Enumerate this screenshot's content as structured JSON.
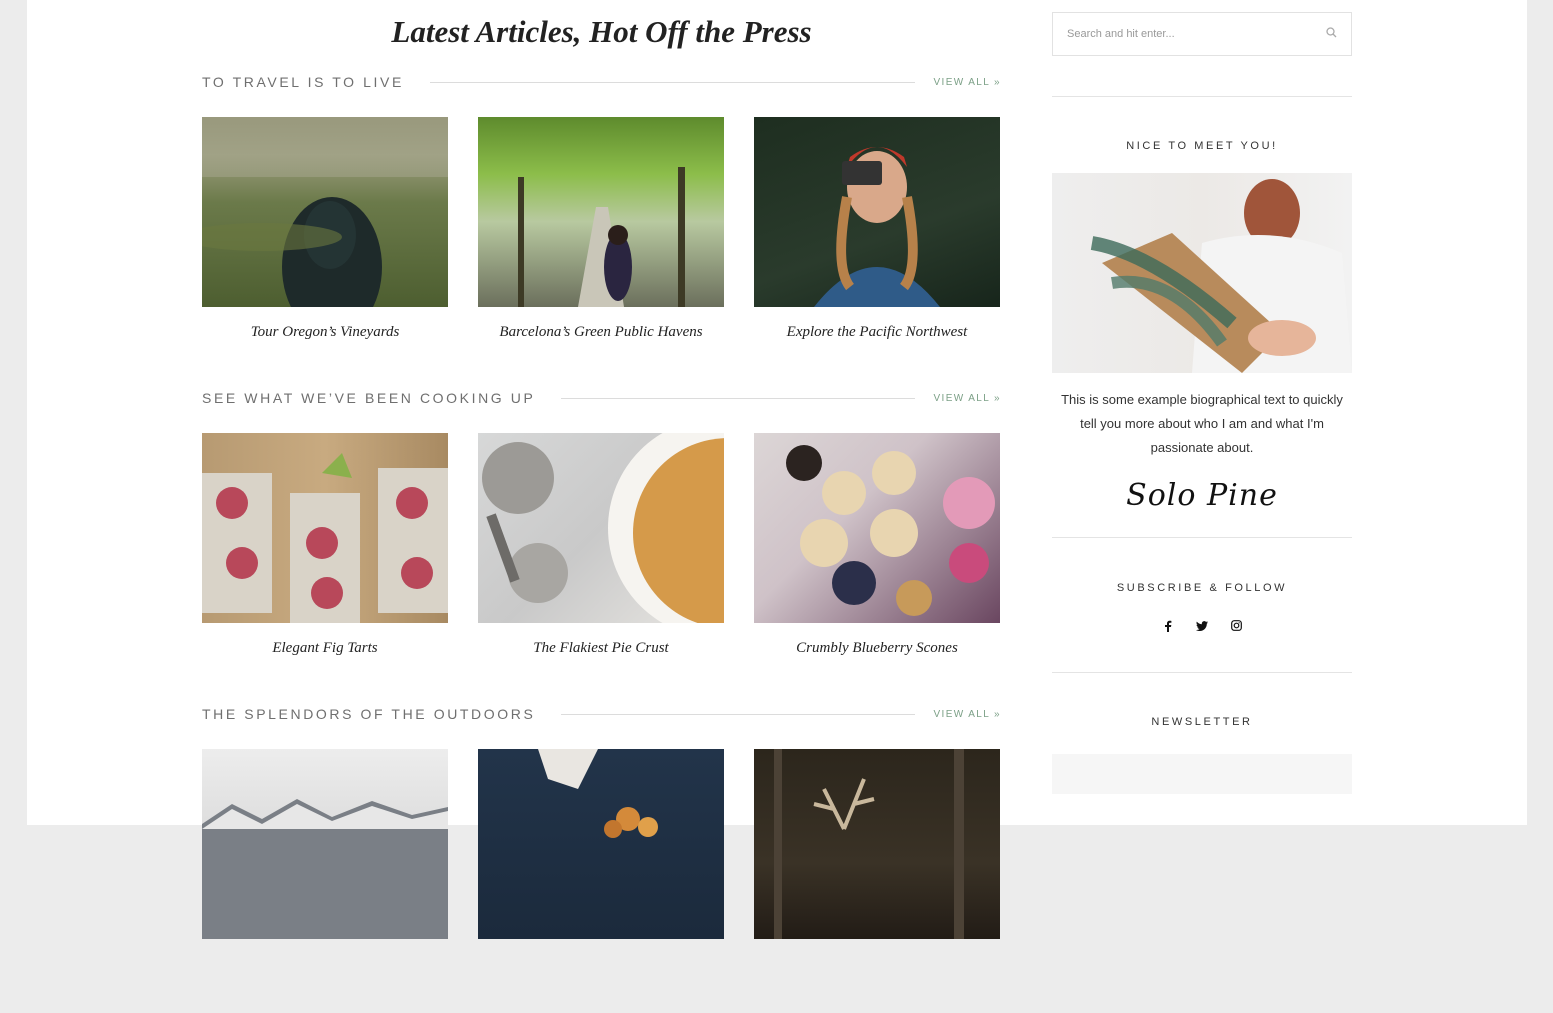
{
  "page": {
    "headline": "Latest Articles, Hot Off the Press"
  },
  "sections": [
    {
      "title": "TO TRAVEL IS TO LIVE",
      "view_all": "VIEW ALL »",
      "posts": [
        {
          "title": "Tour Oregon’s Vineyards",
          "image": "hooded-person-in-field-photo"
        },
        {
          "title": "Barcelona’s Green Public Havens",
          "image": "tree-lined-park-path-photo"
        },
        {
          "title": "Explore the Pacific Northwest",
          "image": "woman-with-camera-photo"
        }
      ]
    },
    {
      "title": "SEE WHAT WE’VE BEEN COOKING UP",
      "view_all": "VIEW ALL »",
      "posts": [
        {
          "title": "Elegant Fig Tarts",
          "image": "fig-tarts-photo"
        },
        {
          "title": "The Flakiest Pie Crust",
          "image": "pie-crust-photo"
        },
        {
          "title": "Crumbly Blueberry Scones",
          "image": "blueberry-scones-photo"
        }
      ]
    },
    {
      "title": "THE SPLENDORS OF THE OUTDOORS",
      "view_all": "VIEW ALL »",
      "posts": [
        {
          "title": "",
          "image": "snowy-mountains-photo"
        },
        {
          "title": "",
          "image": "dried-citrus-photo"
        },
        {
          "title": "",
          "image": "antlers-in-forest-photo"
        }
      ]
    }
  ],
  "sidebar": {
    "search": {
      "placeholder": "Search and hit enter...",
      "icon": "search-icon"
    },
    "about": {
      "title": "NICE TO MEET YOU!",
      "image": "woman-holding-evergreen-bouquet-photo",
      "bio": "This is some example biographical text to quickly tell you more about who I am and what I'm passionate about.",
      "signature": "Solo Pine"
    },
    "follow": {
      "title": "SUBSCRIBE & FOLLOW",
      "icons": [
        "facebook-icon",
        "twitter-icon",
        "instagram-icon"
      ]
    },
    "newsletter": {
      "title": "NEWSLETTER"
    }
  },
  "colors": {
    "accent": "#7ca087",
    "background": "#ececec",
    "text": "#333333"
  }
}
